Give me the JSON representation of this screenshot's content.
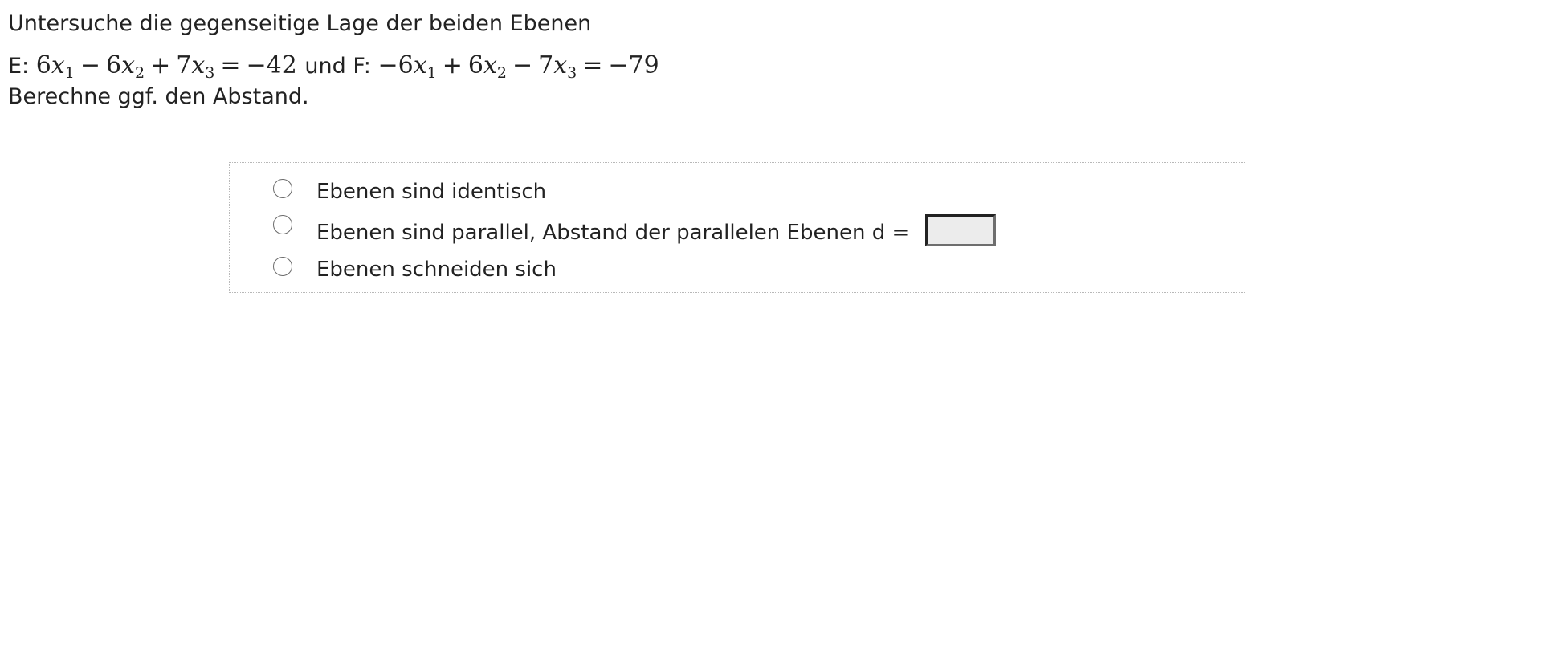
{
  "question": {
    "line1": "Untersuche die gegenseitige Lage der beiden Ebenen",
    "plane_e_label": "E:",
    "connector": "und",
    "plane_f_label": "F:",
    "line3": "Berechne ggf. den Abstand."
  },
  "plane_e": {
    "t1": "6",
    "var1": "x",
    "sub1": "1",
    "op1": "−",
    "t2": "6",
    "var2": "x",
    "sub2": "2",
    "op2": "+",
    "t3": "7",
    "var3": "x",
    "sub3": "3",
    "eq": "=",
    "rhs": "−42"
  },
  "plane_f": {
    "t1": "−6",
    "var1": "x",
    "sub1": "1",
    "op1": "+",
    "t2": "6",
    "var2": "x",
    "sub2": "2",
    "op2": "−",
    "t3": "7",
    "var3": "x",
    "sub3": "3",
    "eq": "=",
    "rhs": "−79"
  },
  "options": [
    {
      "label": "Ebenen sind identisch",
      "selected": false
    },
    {
      "label": "Ebenen sind parallel, Abstand der parallelen Ebenen d =",
      "selected": false
    },
    {
      "label": "Ebenen schneiden sich",
      "selected": false
    }
  ],
  "distance_input": {
    "value": "",
    "placeholder": ""
  }
}
